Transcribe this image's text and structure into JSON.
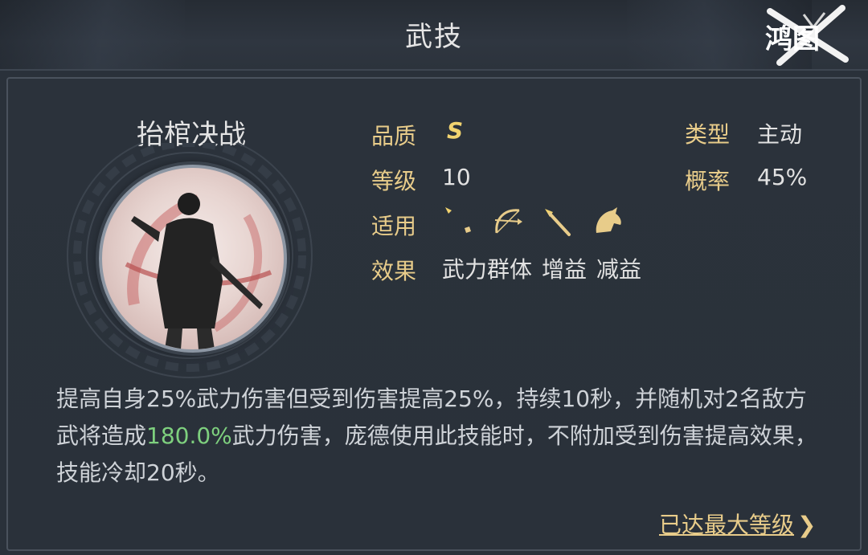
{
  "header": {
    "title": "武技",
    "logo_text": "鸿图"
  },
  "skill": {
    "name": "抬棺决战",
    "attributes": {
      "quality_label": "品质",
      "quality_value": "S",
      "level_label": "等级",
      "level_value": "10",
      "type_label": "类型",
      "type_value": "主动",
      "chance_label": "概率",
      "chance_value": "45%",
      "applicable_label": "适用",
      "applicable_icons": [
        "sword-icon",
        "bow-icon",
        "spear-icon",
        "horse-icon"
      ],
      "effect_label": "效果",
      "effects": [
        "武力群体",
        "增益",
        "减益"
      ]
    },
    "description": {
      "part1": "提高自身25%武力伤害但受到伤害提高25%，持续10秒，并随机对2名敌方武将造成",
      "highlight": "180.0%",
      "part2": "武力伤害，庞德使用此技能时，不附加受到伤害提高效果，技能冷却20秒。"
    }
  },
  "footer": {
    "max_level_label": "已达最大等级",
    "chevron": "❯"
  },
  "colors": {
    "label_gold": "#e8cc8a",
    "quality_gold": "#f1d36f",
    "highlight_green": "#7ed07e",
    "background": "#2a313a"
  }
}
